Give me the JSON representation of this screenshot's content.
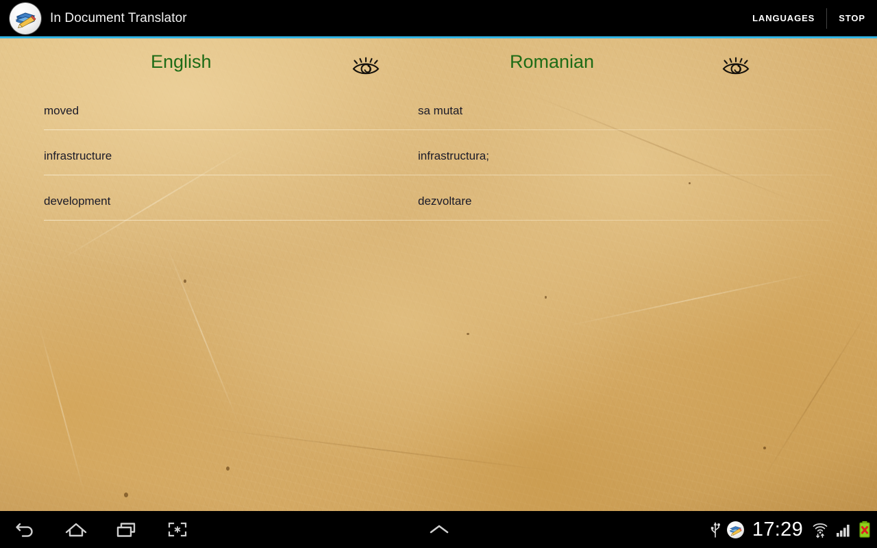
{
  "action_bar": {
    "app_icon": "book-pencil-icon",
    "title": "In Document Translator",
    "languages_label": "LANGUAGES",
    "stop_label": "STOP",
    "accent_color": "#33b5e5",
    "background_color": "#000000"
  },
  "translator": {
    "source": {
      "language": "English",
      "eye_icon": "eye-icon"
    },
    "target": {
      "language": "Romanian",
      "eye_icon": "eye-icon"
    },
    "language_color": "#1d6b16",
    "rows": [
      {
        "source": "moved",
        "target": "sa mutat"
      },
      {
        "source": "infrastructure",
        "target": "infrastructura;"
      },
      {
        "source": "development",
        "target": "dezvoltare"
      }
    ]
  },
  "nav_bar": {
    "buttons": [
      {
        "name": "back-icon",
        "label": "Back"
      },
      {
        "name": "home-icon",
        "label": "Home"
      },
      {
        "name": "recent-apps-icon",
        "label": "Recent apps"
      },
      {
        "name": "screenshot-icon",
        "label": "Screenshot"
      }
    ],
    "handle_icon": "chevron-up-icon",
    "status": {
      "usb_icon": "usb-icon",
      "app_icon": "book-pencil-icon",
      "clock": "17:29",
      "wifi_icon": "wifi-icon",
      "signal_icon": "signal-bars-icon",
      "battery_icon": "battery-error-icon"
    }
  }
}
